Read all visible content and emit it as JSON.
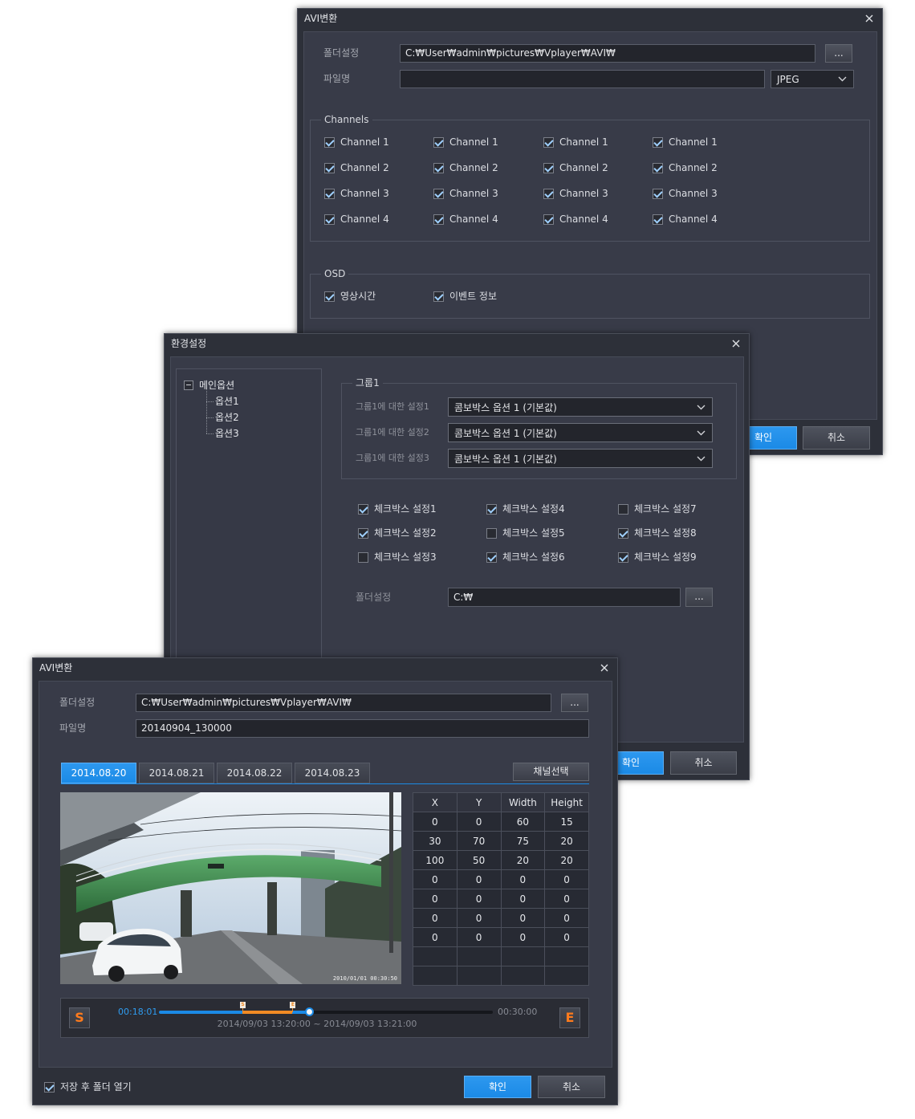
{
  "avi_top": {
    "title": "AVI변환",
    "folder_label": "폴더설정",
    "folder_value": "C:₩User₩admin₩pictures₩Vplayer₩AVI₩",
    "browse_label": "...",
    "filename_label": "파일명",
    "filename_value": "",
    "format_value": "JPEG",
    "channels_legend": "Channels",
    "channel_groups": [
      [
        {
          "label": "Channel 1",
          "checked": true
        },
        {
          "label": "Channel 2",
          "checked": true
        },
        {
          "label": "Channel 3",
          "checked": true
        },
        {
          "label": "Channel 4",
          "checked": true
        }
      ],
      [
        {
          "label": "Channel 1",
          "checked": true
        },
        {
          "label": "Channel 2",
          "checked": true
        },
        {
          "label": "Channel 3",
          "checked": true
        },
        {
          "label": "Channel 4",
          "checked": true
        }
      ],
      [
        {
          "label": "Channel 1",
          "checked": true
        },
        {
          "label": "Channel 2",
          "checked": true
        },
        {
          "label": "Channel 3",
          "checked": true
        },
        {
          "label": "Channel 4",
          "checked": true
        }
      ],
      [
        {
          "label": "Channel 1",
          "checked": true
        },
        {
          "label": "Channel 2",
          "checked": true
        },
        {
          "label": "Channel 3",
          "checked": true
        },
        {
          "label": "Channel 4",
          "checked": true
        }
      ]
    ],
    "osd_legend": "OSD",
    "osd_items": [
      {
        "label": "영상시간",
        "checked": true
      },
      {
        "label": "이벤트 정보",
        "checked": true
      }
    ],
    "ok_label": "확인",
    "cancel_label": "취소"
  },
  "settings": {
    "title": "환경설정",
    "tree": {
      "root": "메인옵션",
      "expanded": true,
      "children": [
        "옵션1",
        "옵션2",
        "옵션3"
      ]
    },
    "group_legend": "그룹1",
    "group_rows": [
      {
        "label": "그룹1에 대한 설정1",
        "value": "콤보박스 옵션 1 (기본값)"
      },
      {
        "label": "그룹1에 대한 설정2",
        "value": "콤보박스 옵션 1 (기본값)"
      },
      {
        "label": "그룹1에 대한 설정3",
        "value": "콤보박스 옵션 1 (기본값)"
      }
    ],
    "checkbox_columns": [
      [
        {
          "label": "체크박스 설정1",
          "checked": true
        },
        {
          "label": "체크박스 설정2",
          "checked": true
        },
        {
          "label": "체크박스 설정3",
          "checked": false
        }
      ],
      [
        {
          "label": "체크박스 설정4",
          "checked": true
        },
        {
          "label": "체크박스 설정5",
          "checked": false
        },
        {
          "label": "체크박스 설정6",
          "checked": true
        }
      ],
      [
        {
          "label": "체크박스 설정7",
          "checked": false
        },
        {
          "label": "체크박스 설정8",
          "checked": true
        },
        {
          "label": "체크박스 설정9",
          "checked": true
        }
      ]
    ],
    "folder_label": "폴더설정",
    "folder_value": "C:₩",
    "browse_label": "...",
    "ok_label": "확인",
    "cancel_label": "취소"
  },
  "avi_front": {
    "title": "AVI변환",
    "folder_label": "폴더설정",
    "folder_value": "C:₩User₩admin₩pictures₩Vplayer₩AVI₩",
    "browse_label": "...",
    "filename_label": "파일명",
    "filename_value": "20140904_130000",
    "tabs": [
      {
        "label": "2014.08.20",
        "active": true
      },
      {
        "label": "2014.08.21",
        "active": false
      },
      {
        "label": "2014.08.22",
        "active": false
      },
      {
        "label": "2014.08.23",
        "active": false
      }
    ],
    "channel_select_label": "채널선택",
    "video_timestamp": "2010/01/01 00:30:50",
    "table": {
      "columns": [
        "X",
        "Y",
        "Width",
        "Height"
      ],
      "rows": [
        [
          0,
          0,
          60,
          15
        ],
        [
          30,
          70,
          75,
          20
        ],
        [
          100,
          50,
          20,
          20
        ],
        [
          0,
          0,
          0,
          0
        ],
        [
          0,
          0,
          0,
          0
        ],
        [
          0,
          0,
          0,
          0
        ],
        [
          0,
          0,
          0,
          0
        ],
        [
          "",
          "",
          "",
          ""
        ],
        [
          "",
          "",
          "",
          ""
        ]
      ]
    },
    "timeline": {
      "start_button": "S",
      "end_button": "E",
      "current_time": "00:18:01",
      "total_time": "00:30:00",
      "range_text": "2014/09/03 13:20:00 ~ 2014/09/03 13:21:00",
      "marker_start_label": "S",
      "marker_end_label": "E",
      "playhead": 0.45,
      "mark_start": 0.25,
      "mark_end": 0.4
    },
    "open_folder_label": "저장 후 폴더 열기",
    "open_folder_checked": true,
    "ok_label": "확인",
    "cancel_label": "취소"
  },
  "colors": {
    "accent": "#1b8ae6",
    "marker": "#f08a24",
    "timecode": "#2f9cf0"
  }
}
